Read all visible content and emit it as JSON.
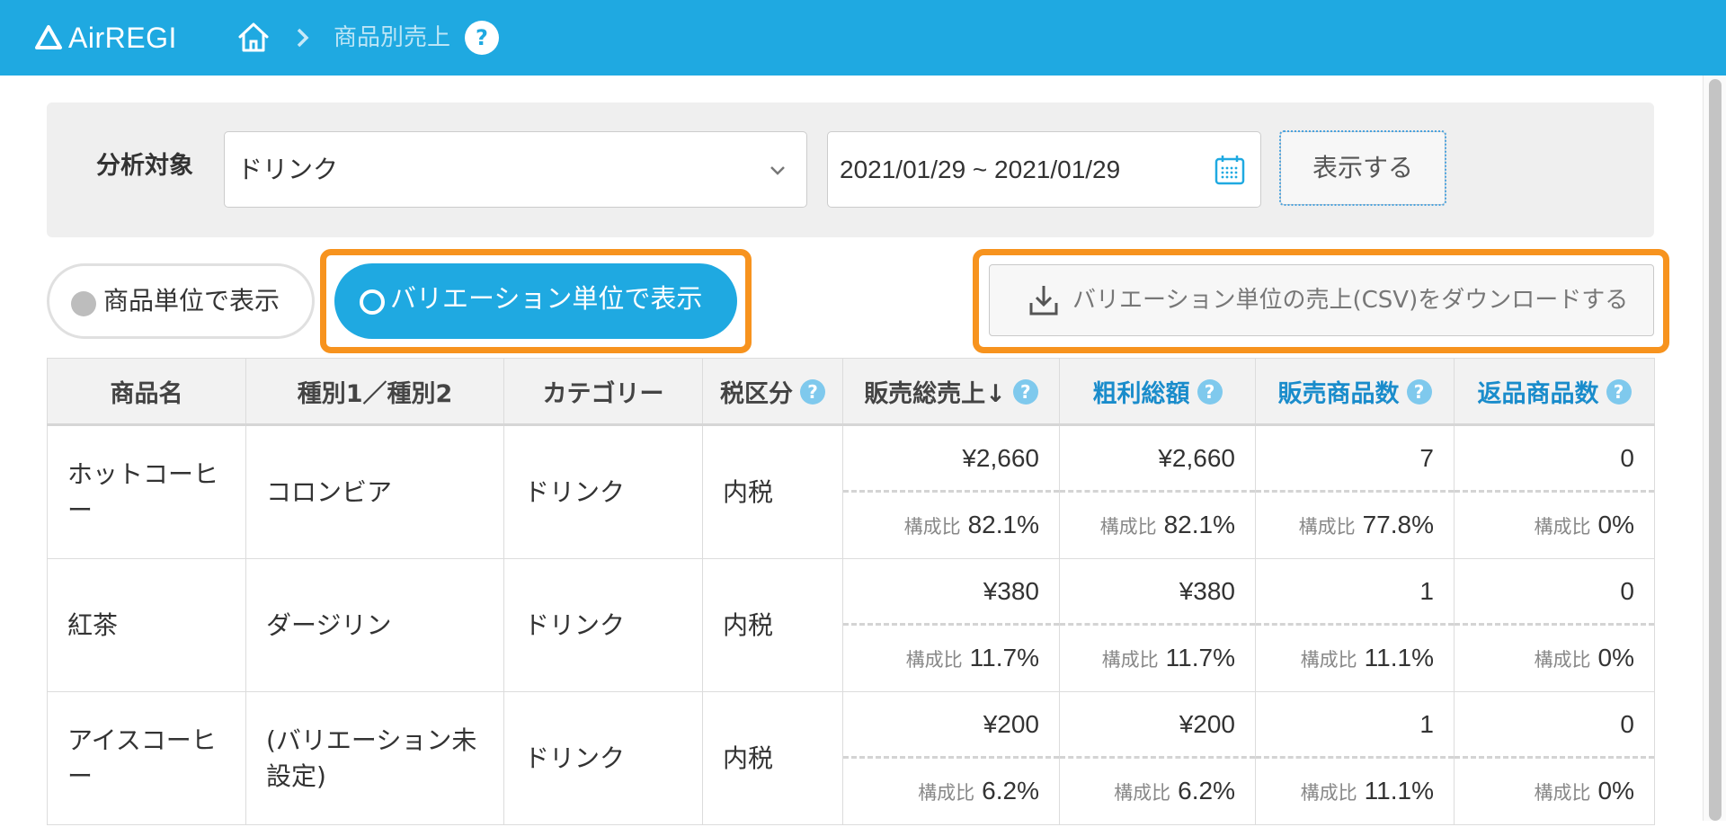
{
  "header": {
    "logo_text": "AirREGI",
    "breadcrumb_current": "商品別売上",
    "help_label": "?",
    "bg_color": "#1fa9e1"
  },
  "filter": {
    "label": "分析対象",
    "select_value": "ドリンク",
    "date_range": "2021/01/29 ~ 2021/01/29",
    "show_button": "表示する"
  },
  "toggles": {
    "product_unit": "商品単位で表示",
    "variation_unit": "バリエーション単位で表示"
  },
  "download": {
    "label": "バリエーション単位の売上(CSV)をダウンロードする"
  },
  "table": {
    "ratio_label": "構成比",
    "help_label": "?",
    "headers": [
      "商品名",
      "種別1／種別2",
      "カテゴリー",
      "税区分",
      "販売総売上↓",
      "粗利総額",
      "販売商品数",
      "返品商品数"
    ],
    "rows": [
      {
        "name": "ホットコーヒー",
        "variation": "コロンビア",
        "category": "ドリンク",
        "tax": "内税",
        "sales": "¥2,660",
        "sales_ratio": "82.1%",
        "profit": "¥2,660",
        "profit_ratio": "82.1%",
        "qty": "7",
        "qty_ratio": "77.8%",
        "returns": "0",
        "returns_ratio": "0%"
      },
      {
        "name": "紅茶",
        "variation": "ダージリン",
        "category": "ドリンク",
        "tax": "内税",
        "sales": "¥380",
        "sales_ratio": "11.7%",
        "profit": "¥380",
        "profit_ratio": "11.7%",
        "qty": "1",
        "qty_ratio": "11.1%",
        "returns": "0",
        "returns_ratio": "0%"
      },
      {
        "name": "アイスコーヒー",
        "variation": "(バリエーション未設定)",
        "category": "ドリンク",
        "tax": "内税",
        "sales": "¥200",
        "sales_ratio": "6.2%",
        "profit": "¥200",
        "profit_ratio": "6.2%",
        "qty": "1",
        "qty_ratio": "11.1%",
        "returns": "0",
        "returns_ratio": "0%"
      }
    ]
  },
  "colors": {
    "accent": "#1fa9e1",
    "highlight": "#f7931e",
    "link": "#1a8ccb"
  }
}
